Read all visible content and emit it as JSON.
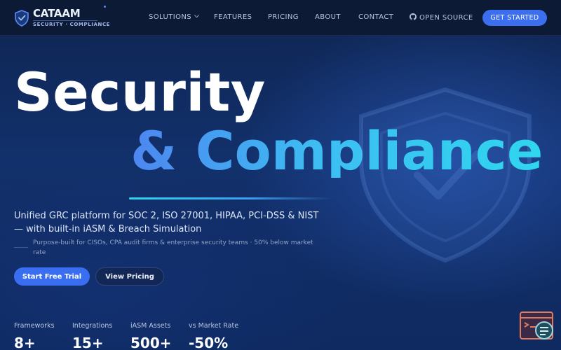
{
  "brand": {
    "name": "CATAAM",
    "tagline": "SECURITY · COMPLIANCE",
    "accent_color": "#3b6ff0",
    "highlight_color": "#2fd6ef"
  },
  "nav": {
    "items": [
      {
        "label": "SOLUTIONS",
        "has_dropdown": true
      },
      {
        "label": "FEATURES"
      },
      {
        "label": "PRICING"
      },
      {
        "label": "ABOUT"
      },
      {
        "label": "CONTACT"
      },
      {
        "label": "OPEN SOURCE",
        "icon": "github-icon"
      }
    ],
    "cta": "GET STARTED"
  },
  "hero": {
    "title_line1": "Security",
    "title_line2": "& Compliance",
    "subtitle": "Unified GRC platform for SOC 2, ISO 27001, HIPAA, PCI-DSS & NIST — with built-in iASM & Breach Simulation",
    "note": "Purpose-built for CISOs, CPA audit firms & enterprise security teams · 50% below market rate",
    "primary_button": "Start Free Trial",
    "secondary_button": "View Pricing",
    "background_icon": "shield-check-icon"
  },
  "stats": [
    {
      "label": "Frameworks",
      "value": "8+"
    },
    {
      "label": "Integrations",
      "value": "15+"
    },
    {
      "label": "iASM Assets",
      "value": "500+"
    },
    {
      "label": "vs Market Rate",
      "value": "-50%"
    }
  ],
  "widget": {
    "icon": "terminal-chat-icon"
  }
}
